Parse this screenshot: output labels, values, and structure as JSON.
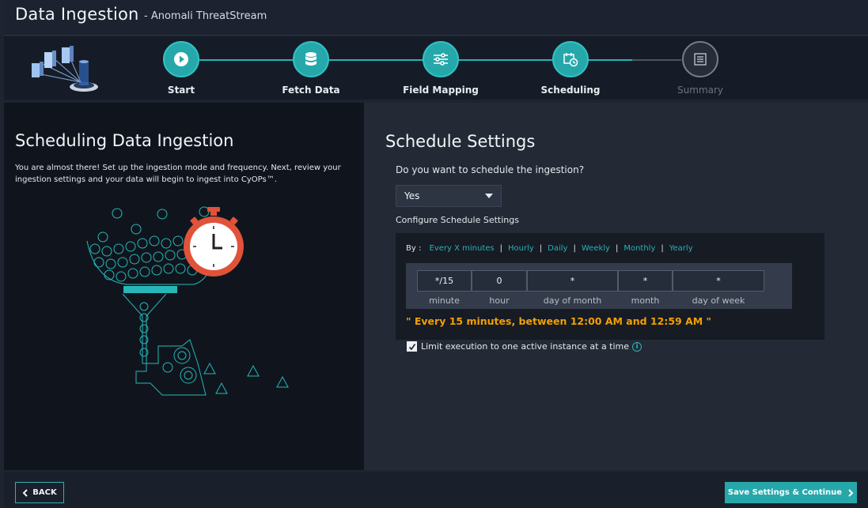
{
  "header": {
    "title": "Data Ingestion",
    "subtitle": "- Anomali ThreatStream"
  },
  "wizard": {
    "steps": [
      {
        "label": "Start",
        "icon": "play-icon",
        "state": "complete"
      },
      {
        "label": "Fetch Data",
        "icon": "database-icon",
        "state": "complete"
      },
      {
        "label": "Field Mapping",
        "icon": "sliders-icon",
        "state": "complete"
      },
      {
        "label": "Scheduling",
        "icon": "calendar-clock-icon",
        "state": "active"
      },
      {
        "label": "Summary",
        "icon": "document-icon",
        "state": "inactive"
      }
    ]
  },
  "left": {
    "title": "Scheduling Data Ingestion",
    "description": "You are almost there! Set up the ingestion mode and frequency. Next, review your ingestion settings and your data will begin to ingest into CyOPs™."
  },
  "right": {
    "title": "Schedule Settings",
    "question": "Do you want to schedule the ingestion?",
    "schedule_select": {
      "value": "Yes"
    },
    "config_label": "Configure Schedule Settings",
    "by_label": "By :",
    "by_options": [
      "Every X minutes",
      "Hourly",
      "Daily",
      "Weekly",
      "Monthly",
      "Yearly"
    ],
    "cron": {
      "minute": {
        "value": "*/15",
        "caption": "minute"
      },
      "hour": {
        "value": "0",
        "caption": "hour"
      },
      "day_of_month": {
        "value": "*",
        "caption": "day of month"
      },
      "month": {
        "value": "*",
        "caption": "month"
      },
      "day_of_week": {
        "value": "*",
        "caption": "day of week"
      }
    },
    "summary": "\" Every 15 minutes, between 12:00 AM and 12:59 AM \"",
    "limit_label": "Limit execution to one active instance at a time",
    "limit_checked": true
  },
  "footer": {
    "back_label": "BACK",
    "save_label": "Save Settings & Continue"
  },
  "colors": {
    "accent": "#26a8ab",
    "summary": "#f2a000",
    "alarm": "#e0533a"
  }
}
